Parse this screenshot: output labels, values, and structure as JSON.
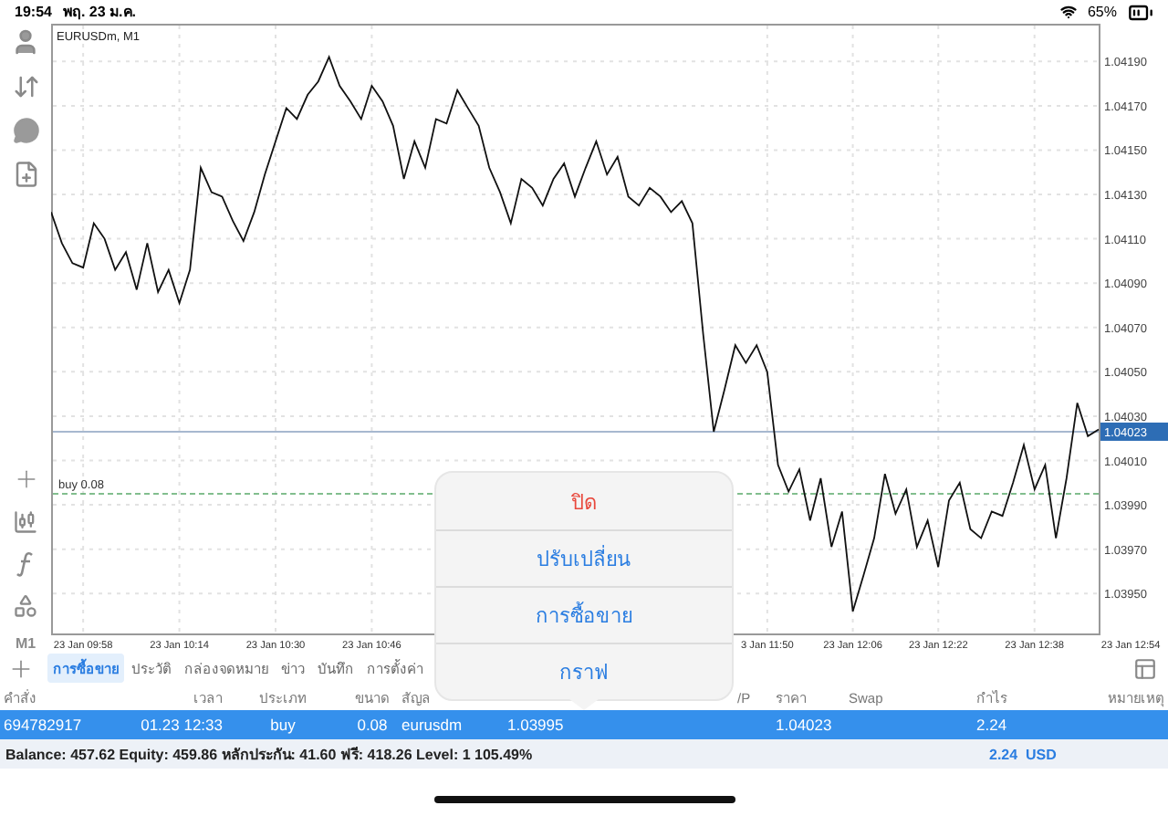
{
  "status_bar": {
    "time": "19:54",
    "date": "พฤ. 23 ม.ค.",
    "battery": "65%"
  },
  "left_toolbar": {
    "timeframe": "M1"
  },
  "chart": {
    "chart_data": {
      "type": "line",
      "title": "EURUSDm, M1",
      "grid": true,
      "categories": [
        null,
        null,
        null,
        "23 Jan 09:58",
        null,
        null,
        null,
        null,
        null,
        null,
        null,
        null,
        "23 Jan 10:14",
        null,
        null,
        null,
        null,
        null,
        null,
        null,
        null,
        "23 Jan 10:30",
        null,
        null,
        null,
        null,
        null,
        null,
        null,
        null,
        "23 Jan 10:46",
        null,
        null,
        null,
        null,
        null,
        null,
        null,
        null,
        null,
        null,
        null,
        null,
        null,
        null,
        null,
        null,
        null,
        null,
        null,
        null,
        null,
        null,
        null,
        null,
        null,
        null,
        null,
        null,
        null,
        null,
        null,
        null,
        null,
        null,
        null,
        null,
        "3 Jan 11:50",
        null,
        null,
        null,
        null,
        null,
        null,
        null,
        "23 Jan 12:06",
        null,
        null,
        null,
        null,
        null,
        null,
        null,
        "23 Jan 12:22",
        null,
        null,
        null,
        null,
        null,
        null,
        null,
        null,
        "23 Jan 12:38",
        null,
        null,
        null,
        null,
        null,
        null,
        null,
        null,
        "23 Jan 12:54"
      ],
      "values": [
        1.04122,
        1.04108,
        1.04099,
        1.04097,
        1.04117,
        1.0411,
        1.04096,
        1.04104,
        1.04087,
        1.04108,
        1.04086,
        1.04096,
        1.04081,
        1.04096,
        1.04142,
        1.04131,
        1.04129,
        1.04118,
        1.04109,
        1.04122,
        1.04139,
        1.04154,
        1.04169,
        1.04164,
        1.04175,
        1.04181,
        1.04192,
        1.04179,
        1.04172,
        1.04164,
        1.04179,
        1.04172,
        1.04161,
        1.04137,
        1.04154,
        1.04142,
        1.04164,
        1.04162,
        1.04177,
        1.04169,
        1.04161,
        1.04142,
        1.04131,
        1.04117,
        1.04137,
        1.04133,
        1.04125,
        1.04137,
        1.04144,
        1.04129,
        1.04142,
        1.04154,
        1.04139,
        1.04147,
        1.04129,
        1.04125,
        1.04133,
        1.04129,
        1.04122,
        1.04127,
        1.04117,
        1.04067,
        1.04023,
        1.04042,
        1.04062,
        1.04054,
        1.04062,
        1.0405,
        1.04008,
        1.03996,
        1.04006,
        1.03983,
        1.04002,
        1.03971,
        1.03987,
        1.03942,
        1.03958,
        1.03975,
        1.04004,
        1.03986,
        1.03997,
        1.03971,
        1.03983,
        1.03962,
        1.03992,
        1.04,
        1.03979,
        1.03975,
        1.03987,
        1.03985,
        1.04,
        1.04017,
        1.03997,
        1.04008,
        1.03975,
        1.04002,
        1.04036,
        1.04021,
        1.04024,
        null,
        null,
        null
      ],
      "ylim": [
        1.03932,
        1.04207
      ],
      "yticks": [
        {
          "value": 1.0419,
          "label": "1.04190"
        },
        {
          "value": 1.0417,
          "label": "1.04170"
        },
        {
          "value": 1.0415,
          "label": "1.04150"
        },
        {
          "value": 1.0413,
          "label": "1.04130"
        },
        {
          "value": 1.0411,
          "label": "1.04110"
        },
        {
          "value": 1.0409,
          "label": "1.04090"
        },
        {
          "value": 1.0407,
          "label": "1.04070"
        },
        {
          "value": 1.0405,
          "label": "1.04050"
        },
        {
          "value": 1.0403,
          "label": "1.04030"
        },
        {
          "value": 1.0401,
          "label": "1.04010"
        },
        {
          "value": 1.0399,
          "label": "1.03990"
        },
        {
          "value": 1.0397,
          "label": "1.03970"
        },
        {
          "value": 1.0395,
          "label": "1.03950"
        }
      ],
      "ref_lines": [
        {
          "axis": "y",
          "value": 1.04023,
          "label": "1.04023",
          "color": "#8aa0bf"
        },
        {
          "axis": "y",
          "value": 1.03995,
          "label": "buy 0.08",
          "color": "#59a96a"
        }
      ]
    }
  },
  "tabs": [
    {
      "label": "การซื้อขาย",
      "selected": true
    },
    {
      "label": "ประวัติ",
      "selected": false
    },
    {
      "label": "กล่องจดหมาย",
      "selected": false
    },
    {
      "label": "ข่าว",
      "selected": false
    },
    {
      "label": "บันทึก",
      "selected": false
    },
    {
      "label": "การตั้งค่า",
      "selected": false
    }
  ],
  "table": {
    "columns": {
      "order": "คำสั่ง",
      "time": "เวลา",
      "type": "ประเภท",
      "size": "ขนาด",
      "symbol": "สัญล",
      "tp": "/P",
      "price": "ราคา",
      "swap": "Swap",
      "profit": "กำไร",
      "comment": "หมายเหตุ"
    },
    "rows": [
      {
        "order": "694782917",
        "time": "01.23 12:33",
        "type": "buy",
        "size": "0.08",
        "symbol": "eurusdm",
        "open_price": "1.03995",
        "price": "1.04023",
        "profit": "2.24",
        "selected": true
      }
    ]
  },
  "summary": {
    "text": "Balance: 457.62 Equity: 459.86 หลักประกัน: 41.60 ฟรี: 418.26 Level: 1 105.49%",
    "profit": "2.24",
    "currency": "USD"
  },
  "popup_menu": [
    {
      "label": "ปิด",
      "kind": "destructive"
    },
    {
      "label": "ปรับเปลี่ยน",
      "kind": "default"
    },
    {
      "label": "การซื้อขาย",
      "kind": "default"
    },
    {
      "label": "กราฟ",
      "kind": "default"
    }
  ]
}
